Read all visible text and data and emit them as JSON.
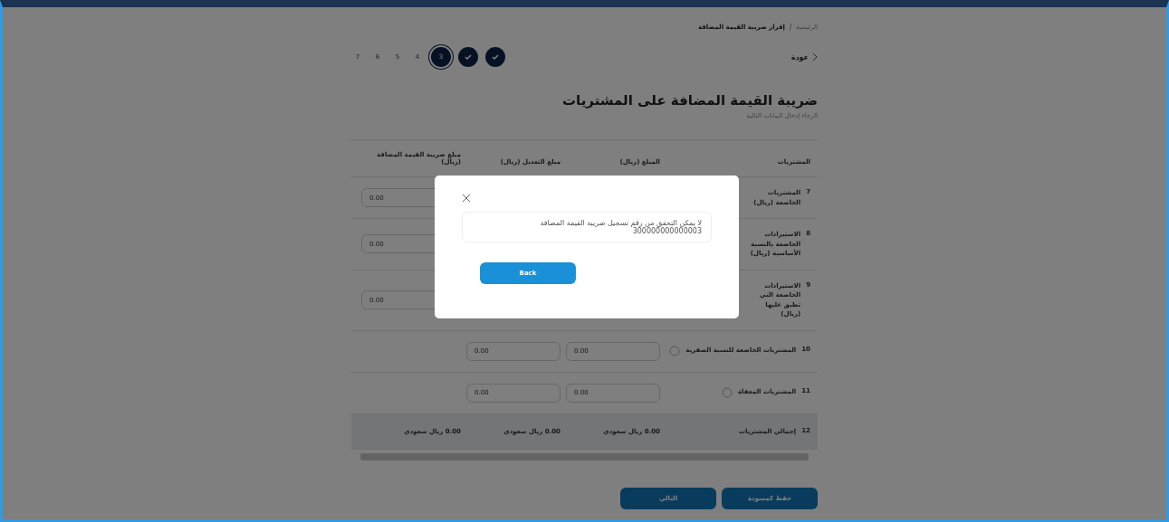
{
  "breadcrumb": [
    {
      "label": "الرئيسية"
    },
    {
      "label": "إقرار ضريبة القيمة المضافة"
    }
  ],
  "back": {
    "label": "عودة"
  },
  "steps": [
    {
      "done": true,
      "selected": false
    },
    {
      "done": true,
      "selected": false
    },
    {
      "done": false,
      "selected": true,
      "label": "3"
    },
    {
      "done": false,
      "selected": false,
      "label": "4"
    },
    {
      "done": false,
      "selected": false,
      "label": "5"
    },
    {
      "done": false,
      "selected": false,
      "label": "6"
    },
    {
      "done": false,
      "selected": false,
      "label": "7"
    }
  ],
  "title": "ضريبة القيمة المضافة على المشتريات",
  "subtitle": "الرجاء إدخال البيانات التالية",
  "table": {
    "columns": [
      "المشتريات",
      "المبلغ (ريال)",
      "مبلغ التعديل (ريال)",
      "مبلغ ضريبة القيمة المضافة (ريال)"
    ],
    "rows": [
      {
        "kind": "item",
        "number": "7",
        "label": "المشتريات الخاضعة (ريال)",
        "vat": "0.00"
      },
      {
        "kind": "item",
        "number": "8",
        "label": "الاستيرادات الخاضعة بالنسبة الأساسية (ريال)",
        "vat": "0.00"
      },
      {
        "kind": "item",
        "number": "9",
        "label": "الاستيرادات الخاضعة التي تطبق عليها (ريال)",
        "vat": "0.00"
      },
      {
        "kind": "item",
        "number": "10",
        "label": "المشتريات الخاضعة للنسبة الصفرية",
        "amount": "0.00",
        "adjustment": "0.00"
      },
      {
        "kind": "item",
        "number": "11",
        "label": "المشتريات المعفاة",
        "amount": "0.00",
        "adjustment": "0.00"
      },
      {
        "kind": "total",
        "number": "12",
        "label": "إجمالي المشتريات",
        "amount": "0.00 ريال سعودي",
        "adjustment": "0.00 ريال سعودي",
        "vat": "0.00 ريال سعودي"
      }
    ]
  },
  "buttons": [
    {
      "label": "حفظ كمسودة"
    },
    {
      "label": "التالي"
    }
  ],
  "modal": {
    "message": "لا يمكن التحقق من رقم تسجيل ضريبة القيمة المضافة 300000000000003",
    "button": "Back"
  }
}
